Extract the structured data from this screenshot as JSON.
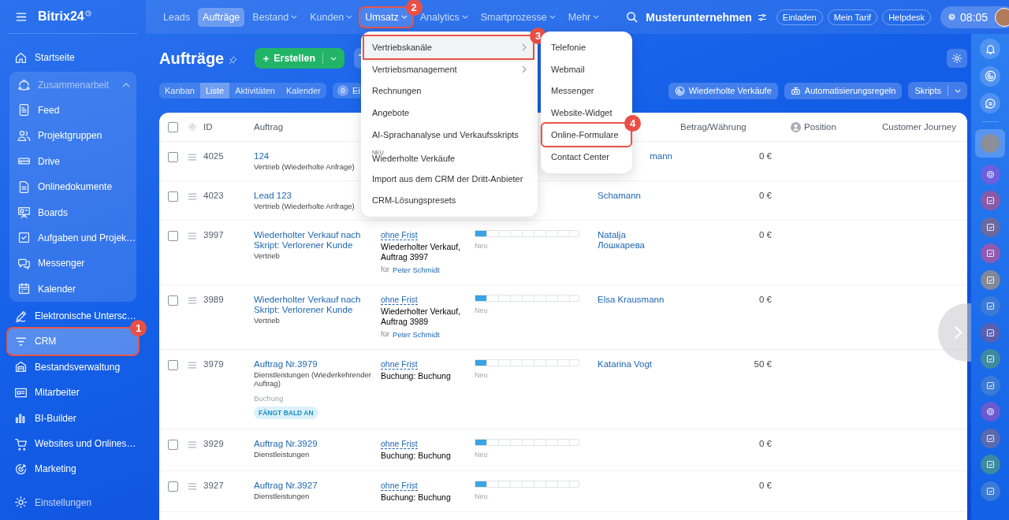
{
  "sidebar": {
    "logo": "Bitrix24",
    "items": [
      {
        "label": "Startseite",
        "selected": false
      },
      {
        "label": "Zusammenarbeit",
        "expanded": true,
        "children": [
          {
            "label": "Feed",
            "selected": false
          },
          {
            "label": "Projektgruppen",
            "selected": false
          },
          {
            "label": "Drive",
            "selected": false
          },
          {
            "label": "Onlinedokumente",
            "selected": false
          },
          {
            "label": "Boards",
            "selected": false
          },
          {
            "label": "Aufgaben und Projek…",
            "selected": false
          },
          {
            "label": "Messenger",
            "selected": false
          },
          {
            "label": "Kalender",
            "selected": false
          }
        ]
      },
      {
        "label": "Elektronische Untersc…",
        "selected": false
      },
      {
        "label": "CRM",
        "selected": true,
        "callout": "1"
      },
      {
        "label": "Bestandsverwaltung",
        "selected": false
      },
      {
        "label": "Mitarbeiter",
        "selected": false
      },
      {
        "label": "BI-Builder",
        "selected": false
      },
      {
        "label": "Websites und Onlines…",
        "selected": false
      },
      {
        "label": "Marketing",
        "selected": false
      }
    ],
    "footer": "Einstellungen"
  },
  "topbar": {
    "nav": [
      {
        "label": "Leads",
        "selected": false,
        "dropdown": false
      },
      {
        "label": "Aufträge",
        "selected": true,
        "dropdown": false
      },
      {
        "label": "Bestand",
        "selected": false,
        "dropdown": true
      },
      {
        "label": "Kunden",
        "selected": false,
        "dropdown": true
      },
      {
        "label": "Umsatz",
        "selected": false,
        "dropdown": true,
        "callout": "2"
      },
      {
        "label": "Analytics",
        "selected": false,
        "dropdown": true
      },
      {
        "label": "Smartprozesse",
        "selected": false,
        "dropdown": true
      },
      {
        "label": "Mehr",
        "selected": false,
        "dropdown": true
      }
    ],
    "company": "Musterunternehmen",
    "buttons": [
      "Einladen",
      "Mein Tarif",
      "Helpdesk"
    ],
    "time": "08:05"
  },
  "page": {
    "title": "Aufträge",
    "create_button": "Erstellen",
    "views": [
      {
        "label": "Kanban",
        "selected": false
      },
      {
        "label": "Liste",
        "selected": true
      },
      {
        "label": "Aktivitäten",
        "selected": false
      },
      {
        "label": "Kalender",
        "selected": false
      }
    ],
    "counter": {
      "count": "0",
      "label": "Ei"
    },
    "actions": [
      "Wiederholte Verkäufe",
      "Automatisierungsregeln"
    ],
    "scripts_button": "Skripts"
  },
  "table": {
    "all_checked": false,
    "columns": {
      "id": "ID",
      "title": "Auftrag",
      "amount": "Betrag/Währung",
      "position": "Position",
      "journey": "Customer Journey"
    },
    "rows": [
      {
        "id": "4025",
        "checked": false,
        "title": "124",
        "subtitle": "Vertrieb (Wiederholte Anfrage)",
        "client": "mann",
        "client_clipped": true,
        "amount": "0 €"
      },
      {
        "id": "4023",
        "checked": false,
        "title": "Lead 123",
        "subtitle": "Vertrieb (Wiederholte Anfrage)",
        "client": "Schamann",
        "amount": "0 €"
      },
      {
        "id": "3997",
        "checked": false,
        "title": "Wiederholter Verkauf nach Skript: Verlorener Kunde",
        "subtitle": "Vertrieb",
        "deadline": "ohne Frist",
        "activity": "Wiederholter Verkauf, Auftrag 3997",
        "assignee_prefix": "für",
        "assignee": "Peter Schmidt",
        "stage": {
          "level": 0.11,
          "label": "Neu"
        },
        "client": "Natalja Лошкарева",
        "amount": "0 €"
      },
      {
        "id": "3989",
        "checked": false,
        "title": "Wiederholter Verkauf nach Skript: Verlorener Kunde",
        "subtitle": "Vertrieb",
        "deadline": "ohne Frist",
        "activity": "Wiederholter Verkauf, Auftrag 3989",
        "assignee_prefix": "für",
        "assignee": "Peter Schmidt",
        "stage": {
          "level": 0.11,
          "label": "Neu"
        },
        "client": "Elsa Krausmann",
        "amount": "0 €"
      },
      {
        "id": "3979",
        "checked": false,
        "title": "Auftrag Nr.3979",
        "subtitle": "Dienstleistungen (Wiederkehrender Auftrag)",
        "note": "Buchung",
        "badge": "FÄNGT BALD AN",
        "deadline": "ohne Frist",
        "activity": "Buchung: Buchung",
        "stage": {
          "level": 0.11,
          "label": "Neu"
        },
        "client": "Katarina Vogt",
        "amount": "50 €"
      },
      {
        "id": "3929",
        "checked": false,
        "title": "Auftrag Nr.3929",
        "subtitle": "Dienstleistungen",
        "deadline": "ohne Frist",
        "activity": "Buchung: Buchung",
        "stage": {
          "level": 0.11,
          "label": "Neu"
        },
        "amount": "0 €"
      },
      {
        "id": "3927",
        "checked": false,
        "title": "Auftrag Nr.3927",
        "subtitle": "Dienstleistungen",
        "deadline": "ohne Frist",
        "activity": "Buchung: Buchung",
        "stage": {
          "level": 0.11,
          "label": "Neu"
        },
        "amount": "0 €"
      }
    ]
  },
  "menu": {
    "items": [
      {
        "label": "Vertriebskanäle",
        "submenu": true,
        "hovered": true,
        "callout": "3"
      },
      {
        "label": "Vertriebsmanagement",
        "submenu": true,
        "hovered": false
      },
      {
        "label": "Rechnungen",
        "submenu": false,
        "hovered": false
      },
      {
        "label": "Angebote",
        "submenu": false,
        "hovered": false
      },
      {
        "label": "AI-Sprachanalyse und Verkaufsskripts",
        "submenu": false,
        "hovered": false
      },
      {
        "label": "Wiederholte Verkäufe",
        "submenu": false,
        "hovered": false,
        "tag": "NEU"
      },
      {
        "label": "Import aus dem CRM der Dritt-Anbieter",
        "submenu": false,
        "hovered": false
      },
      {
        "label": "CRM-Lösungspresets",
        "submenu": false,
        "hovered": false
      }
    ]
  },
  "submenu": {
    "items": [
      {
        "label": "Telefonie"
      },
      {
        "label": "Webmail"
      },
      {
        "label": "Messenger"
      },
      {
        "label": "Website-Widget"
      },
      {
        "label": "Online-Formulare",
        "callout": "4"
      },
      {
        "label": "Contact Center"
      }
    ]
  }
}
